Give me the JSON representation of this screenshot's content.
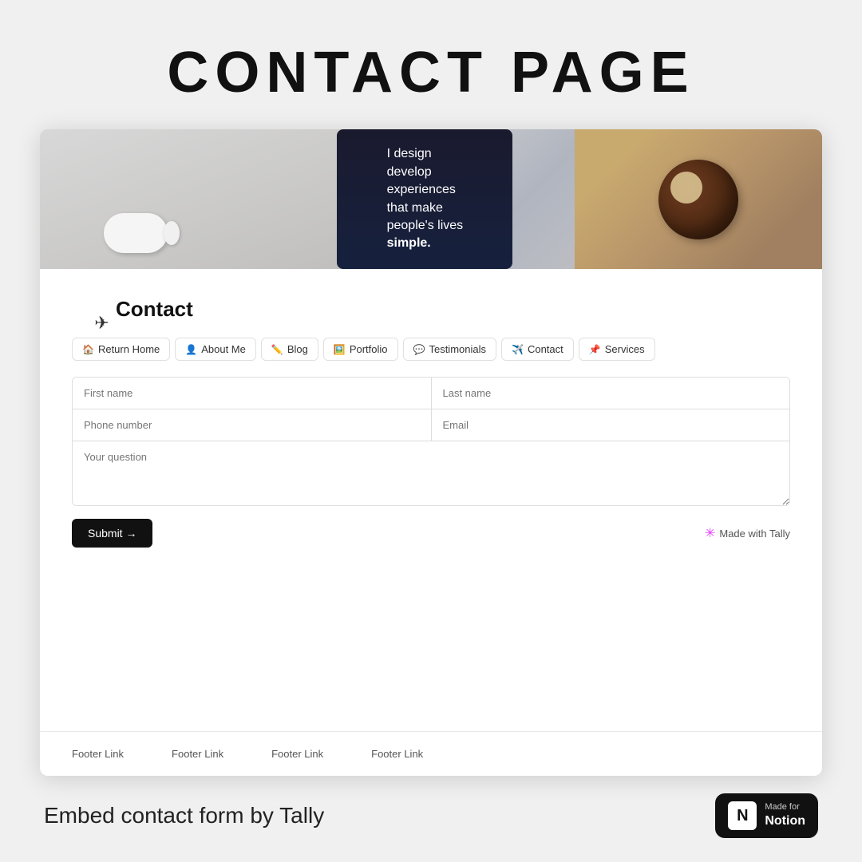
{
  "header": {
    "title": "CONTACT PAGE"
  },
  "hero": {
    "phone_text_line1": "I design",
    "phone_text_line2": "develop",
    "phone_text_line3": "experiences",
    "phone_text_line4": "that make",
    "phone_text_line5": "people's lives",
    "phone_text_line6": "simple."
  },
  "contact": {
    "title": "Contact"
  },
  "nav": {
    "items": [
      {
        "id": "return-home",
        "icon": "🏠",
        "label": "Return Home"
      },
      {
        "id": "about-me",
        "icon": "👤",
        "label": "About Me"
      },
      {
        "id": "blog",
        "icon": "✏️",
        "label": "Blog"
      },
      {
        "id": "portfolio",
        "icon": "🖼️",
        "label": "Portfolio"
      },
      {
        "id": "testimonials",
        "icon": "💬",
        "label": "Testimonials"
      },
      {
        "id": "contact",
        "icon": "✈️",
        "label": "Contact"
      },
      {
        "id": "services",
        "icon": "📌",
        "label": "Services"
      }
    ]
  },
  "form": {
    "first_name_placeholder": "First name",
    "last_name_placeholder": "Last name",
    "phone_placeholder": "Phone number",
    "email_placeholder": "Email",
    "question_placeholder": "Your question",
    "submit_label": "Submit →"
  },
  "tally": {
    "label": "Made with Tally"
  },
  "footer": {
    "links": [
      {
        "label": "Footer Link"
      },
      {
        "label": "Footer Link"
      },
      {
        "label": "Footer Link"
      },
      {
        "label": "Footer Link"
      }
    ]
  },
  "bottom": {
    "embed_text": "Embed contact form by Tally",
    "notion_badge": {
      "made_for": "Made for",
      "name": "Notion"
    }
  }
}
